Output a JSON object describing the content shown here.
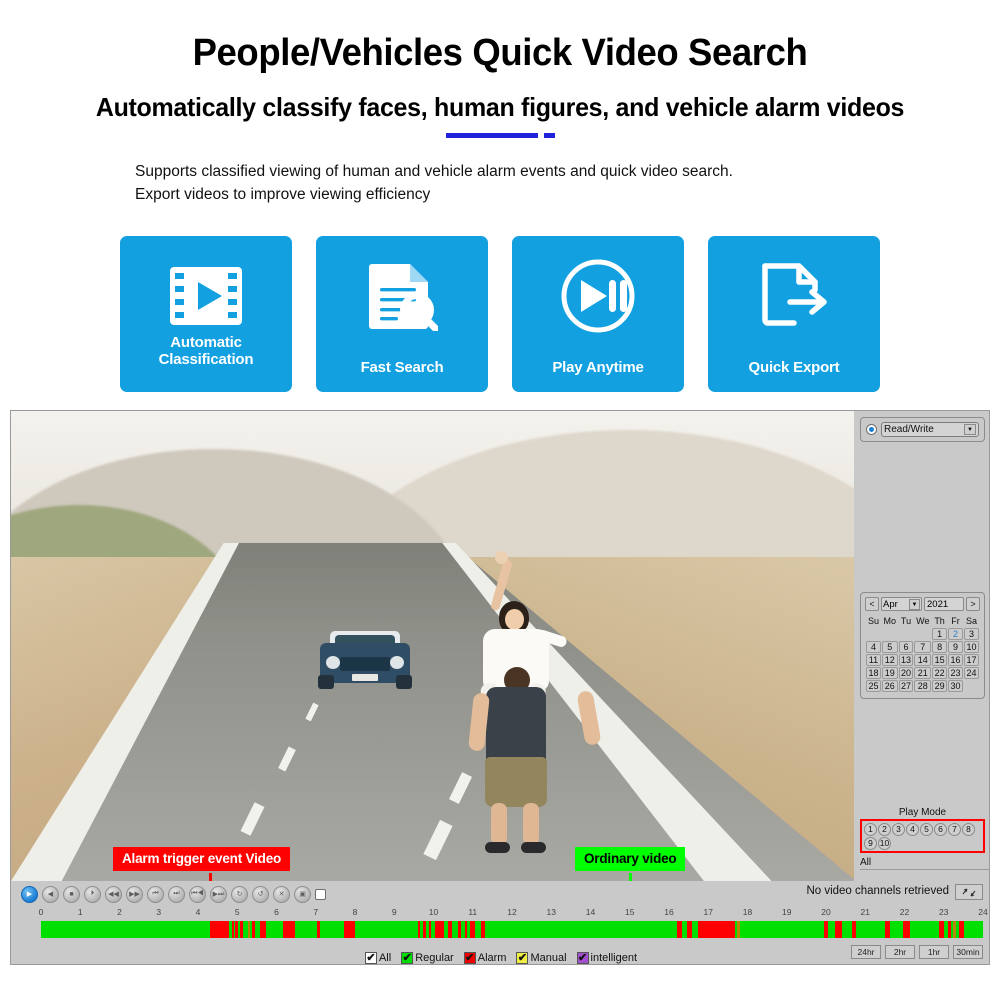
{
  "hero": {
    "title": "People/Vehicles Quick Video Search",
    "subtitle": "Automatically classify faces, human figures, and vehicle alarm videos",
    "body_line1": "Supports classified viewing of human and vehicle alarm events and quick video search.",
    "body_line2": "Export videos to improve viewing efficiency",
    "accent_color": "#2222dd"
  },
  "cards": {
    "accent_color": "#12a0e0",
    "items": [
      {
        "icon": "film-play-icon",
        "label_line1": "Automatic",
        "label_line2": "Classification"
      },
      {
        "icon": "document-search-icon",
        "label_line1": "Fast Search",
        "label_line2": ""
      },
      {
        "icon": "play-pause-circle-icon",
        "label_line1": "Play Anytime",
        "label_line2": ""
      },
      {
        "icon": "document-export-icon",
        "label_line1": "Quick Export",
        "label_line2": ""
      }
    ]
  },
  "annotations": {
    "alarm_label": "Alarm trigger event Video",
    "alarm_color": "#ff0000",
    "ordinary_label": "Ordinary video",
    "ordinary_color": "#00ff00"
  },
  "sidebar": {
    "mode": {
      "selected": "Read/Write",
      "dropdown_arrow": "▼"
    },
    "calendar": {
      "prev": "<",
      "next": ">",
      "month": "Apr",
      "year": "2021",
      "month_arrow": "▼",
      "weekdays": [
        "Su",
        "Mo",
        "Tu",
        "We",
        "Th",
        "Fr",
        "Sa"
      ],
      "lead_blanks": 4,
      "days": [
        1,
        2,
        3,
        4,
        5,
        6,
        7,
        8,
        9,
        10,
        11,
        12,
        13,
        14,
        15,
        16,
        17,
        18,
        19,
        20,
        21,
        22,
        23,
        24,
        25,
        26,
        27,
        28,
        29,
        30
      ],
      "selected_day": 2,
      "selected_color": "#2b7ec4"
    },
    "play_mode": {
      "title": "Play Mode",
      "channels": [
        "1",
        "2",
        "3",
        "4",
        "5",
        "6",
        "7",
        "8",
        "9",
        "10"
      ],
      "highlight_color": "#ff0000",
      "filter_value": "All",
      "search_icon": "magnifier-icon"
    }
  },
  "toolbar": {
    "controls": [
      {
        "name": "play-button",
        "glyph": "▶",
        "primary": true
      },
      {
        "name": "reverse-play-button",
        "glyph": "◀",
        "primary": false
      },
      {
        "name": "stop-button",
        "glyph": "■",
        "primary": false
      },
      {
        "name": "slow-forward-button",
        "glyph": "⏵",
        "primary": false
      },
      {
        "name": "rewind-button",
        "glyph": "◀◀",
        "primary": false
      },
      {
        "name": "fast-forward-button",
        "glyph": "▶▶",
        "primary": false
      },
      {
        "name": "previous-frame-button",
        "glyph": "⏮",
        "primary": false
      },
      {
        "name": "next-frame-button",
        "glyph": "⏭",
        "primary": false
      },
      {
        "name": "previous-file-button",
        "glyph": "⏮◀",
        "primary": false
      },
      {
        "name": "next-file-button",
        "glyph": "▶⏭",
        "primary": false
      },
      {
        "name": "loop-playback-button",
        "glyph": "↻",
        "primary": false
      },
      {
        "name": "repeat-segment-button",
        "glyph": "↺",
        "primary": false
      },
      {
        "name": "clip-cut-button",
        "glyph": "✕",
        "primary": false
      },
      {
        "name": "save-backup-button",
        "glyph": "▣",
        "primary": false
      },
      {
        "name": "fullscreen-toggle",
        "glyph": "",
        "primary": false
      }
    ],
    "status_text": "No video channels retrieved",
    "refresh_icon": "refresh-arrows-icon"
  },
  "timeline": {
    "ticks": [
      0,
      1,
      2,
      3,
      4,
      5,
      6,
      7,
      8,
      9,
      10,
      11,
      12,
      13,
      14,
      15,
      16,
      17,
      18,
      19,
      20,
      21,
      22,
      23,
      24
    ],
    "base_color": "#00e000",
    "alarm_color": "#ff0000",
    "manual_color": "#b8860b",
    "alarm_segments": [
      {
        "start": 4.3,
        "end": 4.78
      },
      {
        "start": 4.86,
        "end": 4.91
      },
      {
        "start": 4.95,
        "end": 5.02
      },
      {
        "start": 5.08,
        "end": 5.14
      },
      {
        "start": 5.38,
        "end": 5.44
      },
      {
        "start": 5.58,
        "end": 5.74
      },
      {
        "start": 6.16,
        "end": 6.48
      },
      {
        "start": 7.02,
        "end": 7.1
      },
      {
        "start": 7.72,
        "end": 8.0
      },
      {
        "start": 9.6,
        "end": 9.66
      },
      {
        "start": 9.74,
        "end": 9.8
      },
      {
        "start": 9.88,
        "end": 9.94
      },
      {
        "start": 10.04,
        "end": 10.28
      },
      {
        "start": 10.38,
        "end": 10.48
      },
      {
        "start": 10.62,
        "end": 10.7
      },
      {
        "start": 10.8,
        "end": 10.86
      },
      {
        "start": 10.94,
        "end": 11.06
      },
      {
        "start": 11.2,
        "end": 11.3
      },
      {
        "start": 16.2,
        "end": 16.34
      },
      {
        "start": 16.46,
        "end": 16.58
      },
      {
        "start": 16.74,
        "end": 17.68
      },
      {
        "start": 19.94,
        "end": 20.06
      },
      {
        "start": 20.24,
        "end": 20.4
      },
      {
        "start": 20.66,
        "end": 20.76
      },
      {
        "start": 21.5,
        "end": 21.64
      },
      {
        "start": 21.96,
        "end": 22.14
      },
      {
        "start": 22.88,
        "end": 23.0
      },
      {
        "start": 23.1,
        "end": 23.18
      },
      {
        "start": 23.38,
        "end": 23.52
      }
    ],
    "manual_segments": [
      {
        "start": 5.28,
        "end": 5.33
      },
      {
        "start": 17.74,
        "end": 17.82
      },
      {
        "start": 23.24,
        "end": 23.3
      }
    ]
  },
  "legend": {
    "items": [
      {
        "label": "All",
        "color": "#ffffff"
      },
      {
        "label": "Regular",
        "color": "#00dd00"
      },
      {
        "label": "Alarm",
        "color": "#ee0000"
      },
      {
        "label": "Manual",
        "color": "#eeee44"
      },
      {
        "label": "intelligent",
        "color": "#a24fd0"
      }
    ],
    "check_glyph": "✔"
  },
  "scale_buttons": [
    "24hr",
    "2hr",
    "1hr",
    "30min"
  ]
}
